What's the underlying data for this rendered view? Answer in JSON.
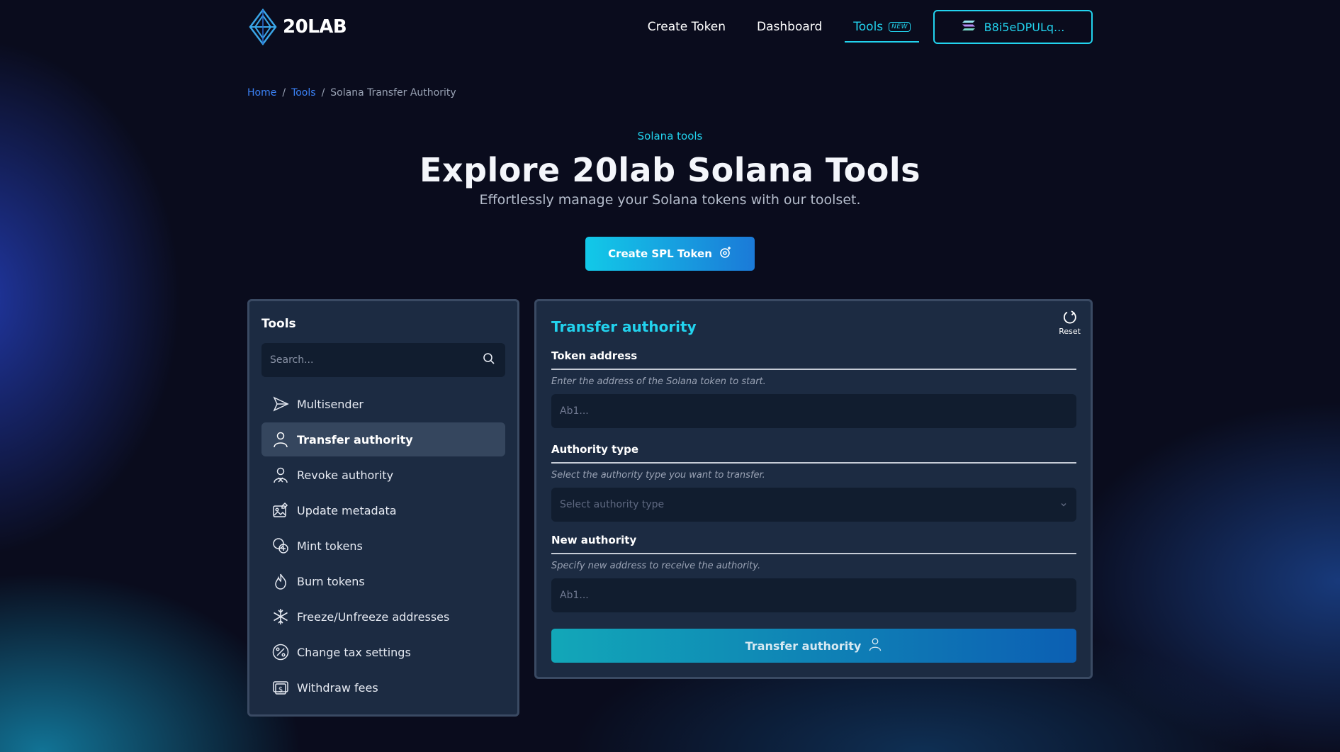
{
  "brand": {
    "name": "20LAB",
    "logo_icon": "diamond-logo-icon"
  },
  "nav": {
    "links": [
      "Create Token",
      "Dashboard"
    ],
    "tools_label": "Tools",
    "tools_badge": "NEW",
    "wallet_address": "B8i5eDPULq..."
  },
  "breadcrumb": {
    "home": "Home",
    "tools": "Tools",
    "current": "Solana Transfer Authority",
    "separator": "/"
  },
  "hero": {
    "eyebrow": "Solana tools",
    "title": "Explore 20lab Solana Tools",
    "subtitle": "Effortlessly manage your Solana tokens with our toolset.",
    "cta_label": "Create SPL Token"
  },
  "sidebar": {
    "title": "Tools",
    "search_placeholder": "Search...",
    "items": [
      {
        "label": "Multisender",
        "icon": "send-icon"
      },
      {
        "label": "Transfer authority",
        "icon": "user-icon",
        "active": true
      },
      {
        "label": "Revoke authority",
        "icon": "user-x-icon"
      },
      {
        "label": "Update metadata",
        "icon": "image-edit-icon"
      },
      {
        "label": "Mint tokens",
        "icon": "coins-plus-icon"
      },
      {
        "label": "Burn tokens",
        "icon": "flame-icon"
      },
      {
        "label": "Freeze/Unfreeze addresses",
        "icon": "snowflake-icon"
      },
      {
        "label": "Change tax settings",
        "icon": "percent-icon"
      },
      {
        "label": "Withdraw fees",
        "icon": "dollar-bill-icon"
      }
    ]
  },
  "form": {
    "title": "Transfer authority",
    "reset_label": "Reset",
    "token_address": {
      "label": "Token address",
      "help": "Enter the address of the Solana token to start.",
      "placeholder": "Ab1..."
    },
    "authority_type": {
      "label": "Authority type",
      "help": "Select the authority type you want to transfer.",
      "placeholder": "Select authority type"
    },
    "new_authority": {
      "label": "New authority",
      "help": "Specify new address to receive the authority.",
      "placeholder": "Ab1..."
    },
    "submit_label": "Transfer authority"
  },
  "colors": {
    "accent": "#22d3ee",
    "panel": "#1c2b42",
    "background": "#0a0c1d",
    "link": "#3b82f6"
  }
}
